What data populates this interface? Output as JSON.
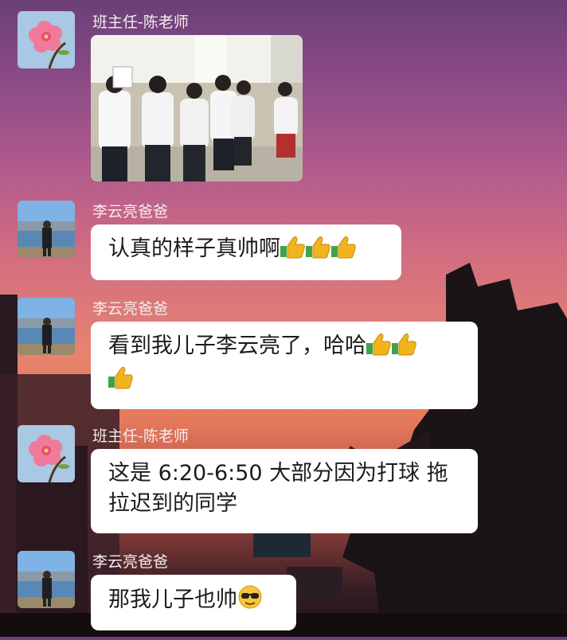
{
  "messages": [
    {
      "sender": "班主任-陈老师",
      "type": "image",
      "avatar": "peach-blossom",
      "image_alt": ""
    },
    {
      "sender": "李云亮爸爸",
      "type": "text",
      "avatar": "man-by-lake",
      "text": "认真的样子真帅啊",
      "emojis": [
        "thumbs-up",
        "thumbs-up",
        "thumbs-up"
      ]
    },
    {
      "sender": "李云亮爸爸",
      "type": "text",
      "avatar": "man-by-lake",
      "text": "看到我儿子李云亮了，哈哈",
      "emojis": [
        "thumbs-up",
        "thumbs-up",
        "thumbs-up"
      ]
    },
    {
      "sender": "班主任-陈老师",
      "type": "text",
      "avatar": "peach-blossom",
      "text_line1": "这是 6:20-6:50 大部分因为打球 拖",
      "text_line2": "拉迟到的同学"
    },
    {
      "sender": "李云亮爸爸",
      "type": "text",
      "avatar": "man-by-lake",
      "text": "那我儿子也帅",
      "emojis": [
        "sunglasses"
      ]
    }
  ],
  "colors": {
    "bubble": "#ffffff",
    "text": "#1c1c1c",
    "name": "#f3ecf0",
    "thumb": "#f2b41c",
    "sleeve": "#3fa447"
  }
}
